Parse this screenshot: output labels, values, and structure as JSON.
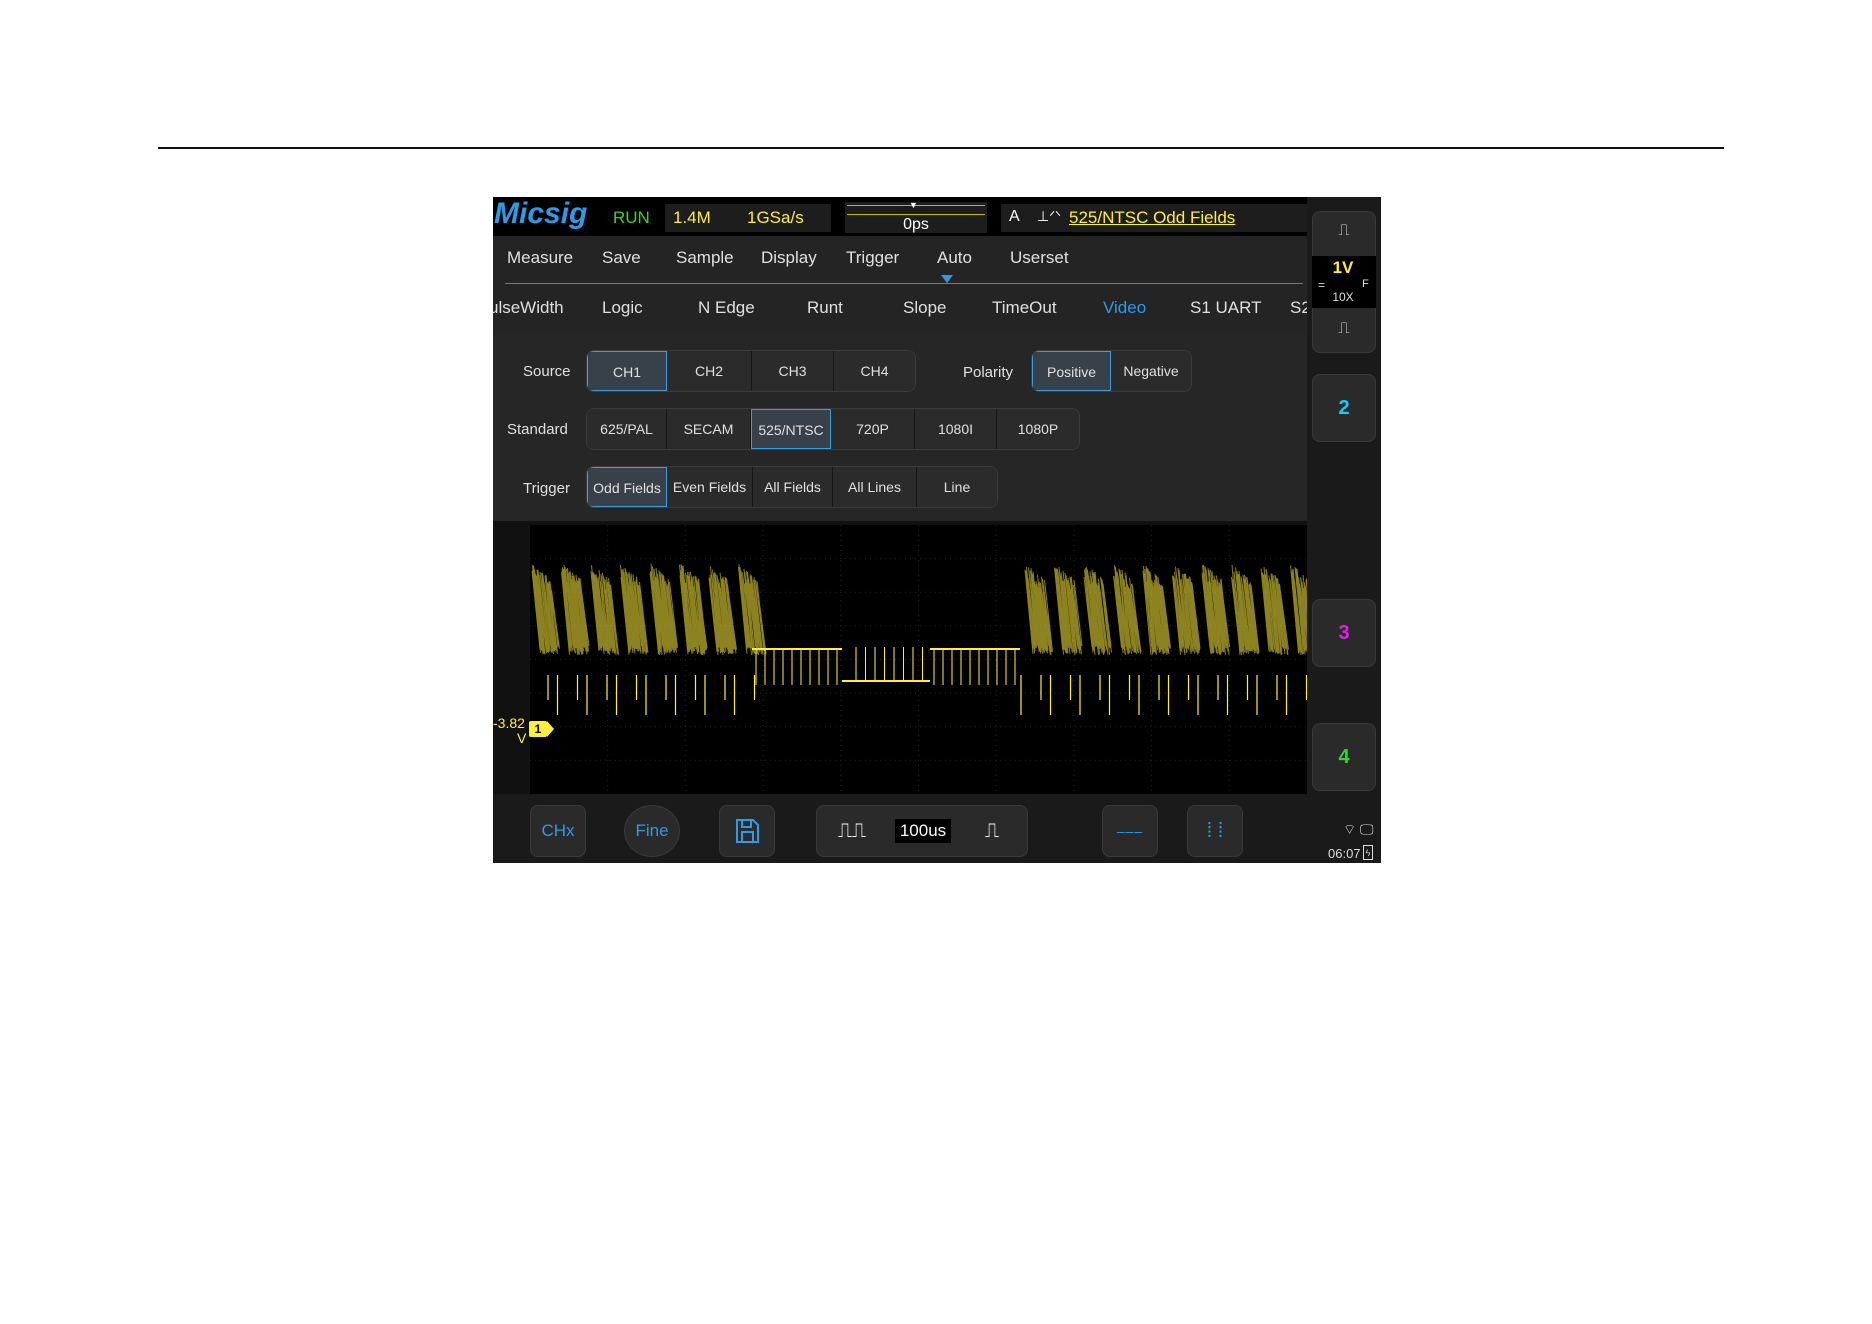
{
  "status": {
    "logo": "Micsig",
    "run": "RUN",
    "memory_depth": "1.4M",
    "sample_rate": "1GSa/s",
    "time_offset": "0ps",
    "trigger_mode": "A",
    "trigger_icon": "video-trigger-icon",
    "trigger_summary": "525/NTSC Odd Fields"
  },
  "menu": {
    "items": [
      "Measure",
      "Save",
      "Sample",
      "Display",
      "Trigger",
      "Auto",
      "Userset"
    ],
    "active": "Trigger"
  },
  "trigger_types": {
    "items": [
      "ulseWidth",
      "Logic",
      "N Edge",
      "Runt",
      "Slope",
      "TimeOut",
      "Video",
      "S1 UART",
      "S2"
    ],
    "active": "Video"
  },
  "video_options": {
    "source_label": "Source",
    "source": [
      "CH1",
      "CH2",
      "CH3",
      "CH4"
    ],
    "source_selected": "CH1",
    "polarity_label": "Polarity",
    "polarity": [
      "Positive",
      "Negative"
    ],
    "polarity_selected": "Positive",
    "standard_label": "Standard",
    "standard": [
      "625/PAL",
      "SECAM",
      "525/NTSC",
      "720P",
      "1080I",
      "1080P"
    ],
    "standard_selected": "525/NTSC",
    "trigger_label": "Trigger",
    "trigger": [
      "Odd Fields",
      "Even Fields",
      "All Fields",
      "All Lines",
      "Line"
    ],
    "trigger_selected": "Odd Fields"
  },
  "channel1": {
    "offset_value": "-3.82",
    "offset_unit": "V",
    "marker": "1",
    "scale": "1V",
    "coupling": "=",
    "bandwidth": "F",
    "probe": "10X"
  },
  "channels": [
    "2",
    "3",
    "4"
  ],
  "channel_colors": {
    "ch1": "#ffef3a",
    "ch2": "#1ec8ff",
    "ch3": "#e020e0",
    "ch4": "#2ed82e",
    "accent": "#2e9be8"
  },
  "toolbar": {
    "chx": "CHx",
    "fine": "Fine",
    "save_icon": "save-icon",
    "timebase": "100us",
    "h_cursor_icon": "horizontal-cursor-icon",
    "v_cursor_icon": "vertical-cursor-icon"
  },
  "system": {
    "time": "06:07",
    "wifi_icon": "wifi-icon",
    "pc_icon": "pc-icon",
    "battery_icon": "battery-icon"
  }
}
